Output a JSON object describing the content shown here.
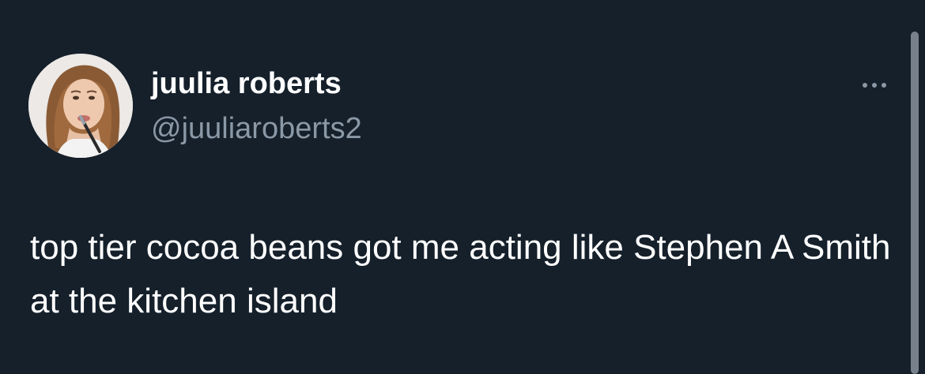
{
  "tweet": {
    "author": {
      "display_name": "juulia roberts",
      "handle": "@juuliaroberts2",
      "avatar_icon": "profile-photo"
    },
    "text": "top tier cocoa beans got me acting like Stephen A Smith at the kitchen island",
    "more_icon": "more-horizontal-icon"
  },
  "theme": {
    "background": "#15202b",
    "text_primary": "#ffffff",
    "text_secondary": "#8b98a5"
  }
}
